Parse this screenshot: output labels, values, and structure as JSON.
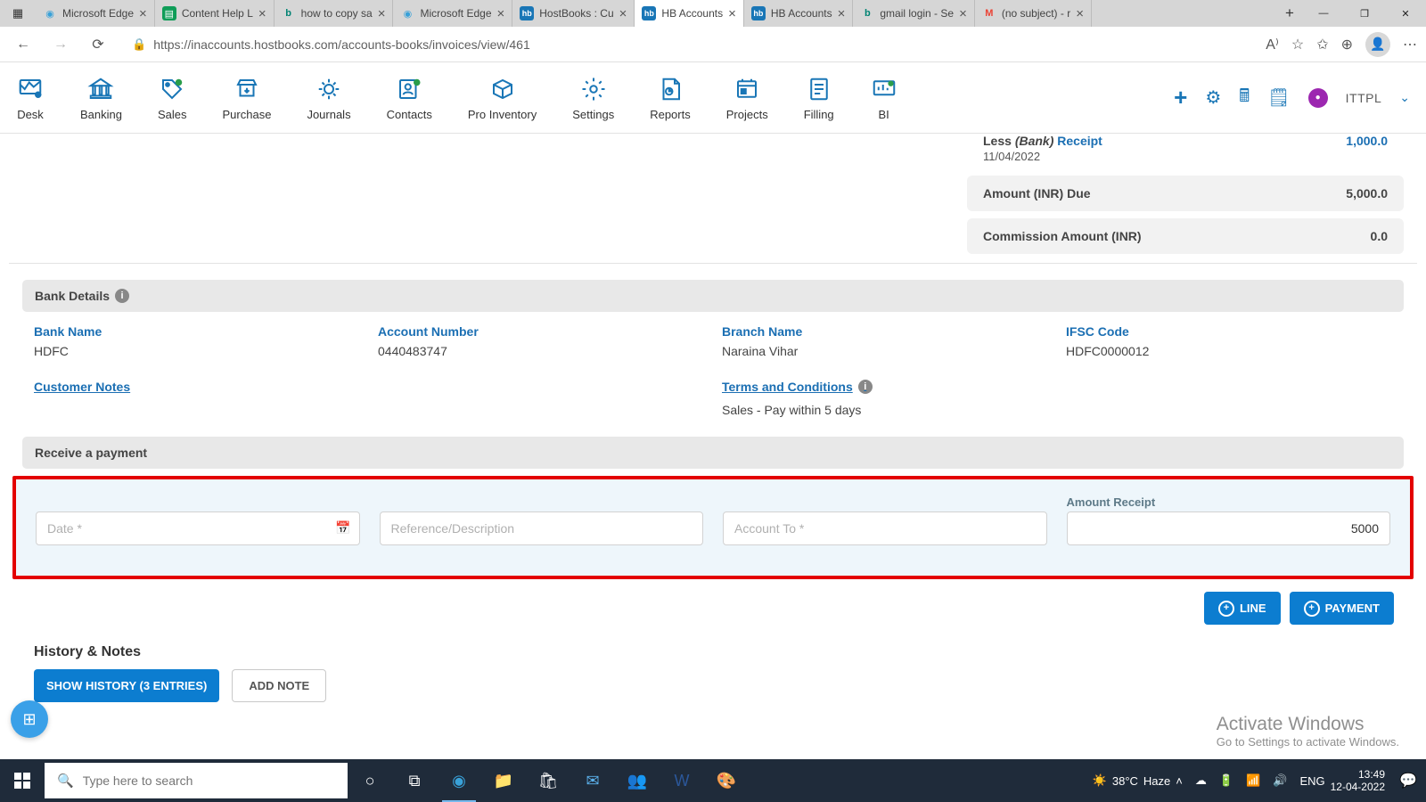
{
  "browser": {
    "tabs": [
      {
        "title": "Microsoft Edge",
        "icon": "🌐"
      },
      {
        "title": "Content Help L",
        "icon": "📄"
      },
      {
        "title": "how to copy sa",
        "icon": "b"
      },
      {
        "title": "Microsoft Edge",
        "icon": "🌐"
      },
      {
        "title": "HostBooks : Cu",
        "icon": "hb"
      },
      {
        "title": "HB Accounts",
        "icon": "hb",
        "active": true
      },
      {
        "title": "HB Accounts",
        "icon": "hb"
      },
      {
        "title": "gmail login - Se",
        "icon": "b"
      },
      {
        "title": "(no subject) - r",
        "icon": "M"
      }
    ],
    "url": "https://inaccounts.hostbooks.com/accounts-books/invoices/view/461"
  },
  "app_nav": {
    "items": [
      "Desk",
      "Banking",
      "Sales",
      "Purchase",
      "Journals",
      "Contacts",
      "Pro Inventory",
      "Settings",
      "Reports",
      "Projects",
      "Filling",
      "BI"
    ],
    "org": "ITTPL"
  },
  "summary": {
    "receipt_label": "Less (Bank) Receipt",
    "receipt_amount": "1,000.0",
    "receipt_date": "11/04/2022",
    "due_label": "Amount (INR) Due",
    "due_value": "5,000.0",
    "commission_label": "Commission Amount (INR)",
    "commission_value": "0.0"
  },
  "bank": {
    "header": "Bank Details",
    "name_label": "Bank Name",
    "name_value": "HDFC",
    "acct_label": "Account Number",
    "acct_value": "0440483747",
    "branch_label": "Branch Name",
    "branch_value": "Naraina Vihar",
    "ifsc_label": "IFSC Code",
    "ifsc_value": "HDFC0000012"
  },
  "links": {
    "customer_notes": "Customer Notes",
    "terms": "Terms and Conditions",
    "terms_text": "Sales - Pay within 5 days"
  },
  "receive": {
    "header": "Receive a payment",
    "date_ph": "Date *",
    "ref_ph": "Reference/Description",
    "acct_ph": "Account To *",
    "amount_label": "Amount Receipt",
    "amount_value": "5000",
    "line_btn": "LINE",
    "payment_btn": "PAYMENT"
  },
  "history": {
    "title": "History & Notes",
    "show_btn": "SHOW HISTORY (3 ENTRIES)",
    "add_btn": "ADD NOTE"
  },
  "watermark": {
    "line1": "Activate Windows",
    "line2": "Go to Settings to activate Windows."
  },
  "taskbar": {
    "search_ph": "Type here to search",
    "weather_temp": "38°C",
    "weather_cond": "Haze",
    "lang": "ENG",
    "time": "13:49",
    "date": "12-04-2022"
  }
}
